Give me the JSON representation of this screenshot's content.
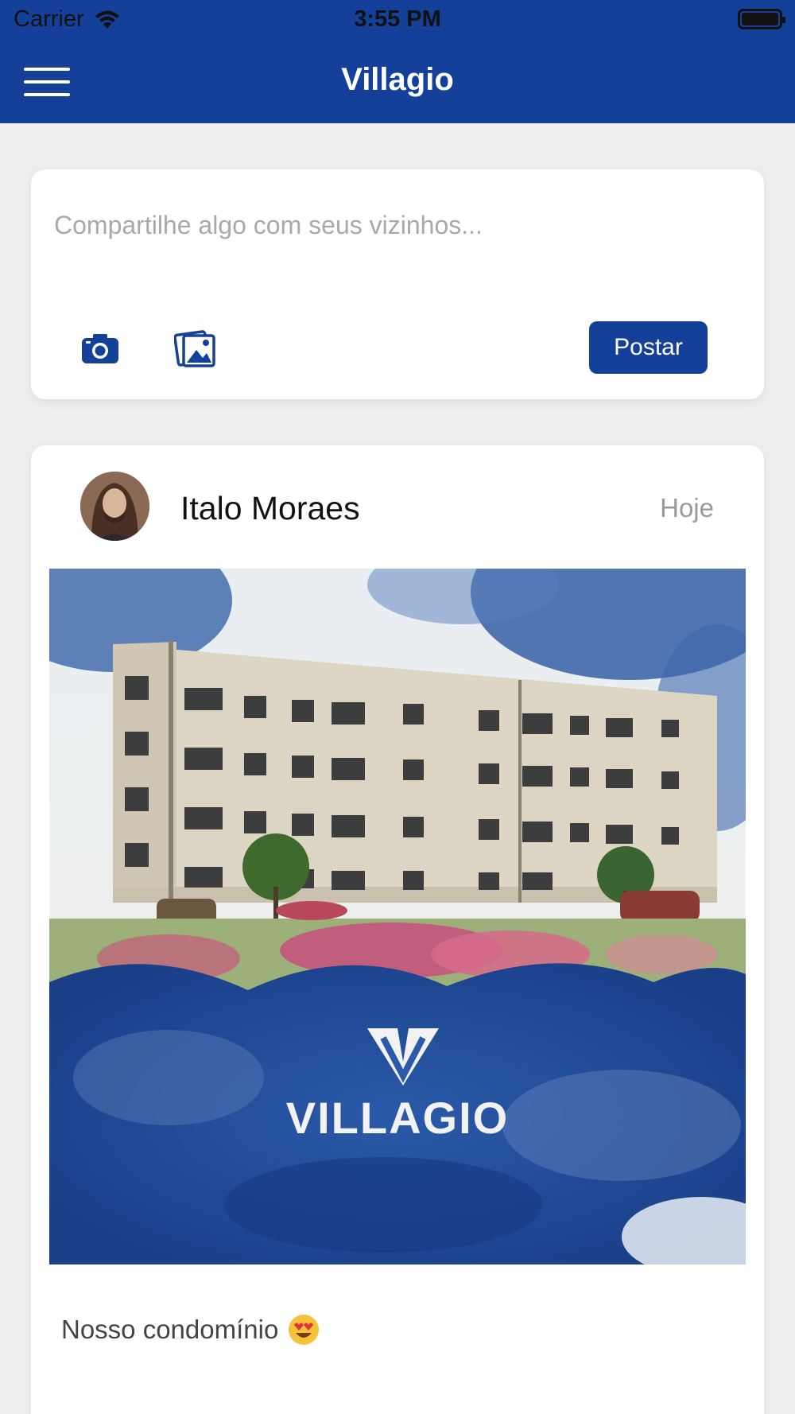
{
  "status_bar": {
    "carrier": "Carrier",
    "time": "3:55 PM"
  },
  "header": {
    "title": "Villagio",
    "menu_icon": "hamburger-menu-icon"
  },
  "composer": {
    "placeholder": "Compartilhe algo com seus vizinhos...",
    "value": "",
    "camera_icon": "camera-icon",
    "gallery_icon": "gallery-icon",
    "post_label": "Postar"
  },
  "feed": {
    "posts": [
      {
        "author": "Italo Moraes",
        "date": "Hoje",
        "image_logo_text": "VILLAGIO",
        "caption": "Nosso condomínio",
        "caption_emoji": "heart-eyes-emoji"
      }
    ]
  },
  "colors": {
    "brand": "#14409a",
    "background": "#efefef",
    "card": "#ffffff",
    "muted": "#9a9a9a"
  }
}
